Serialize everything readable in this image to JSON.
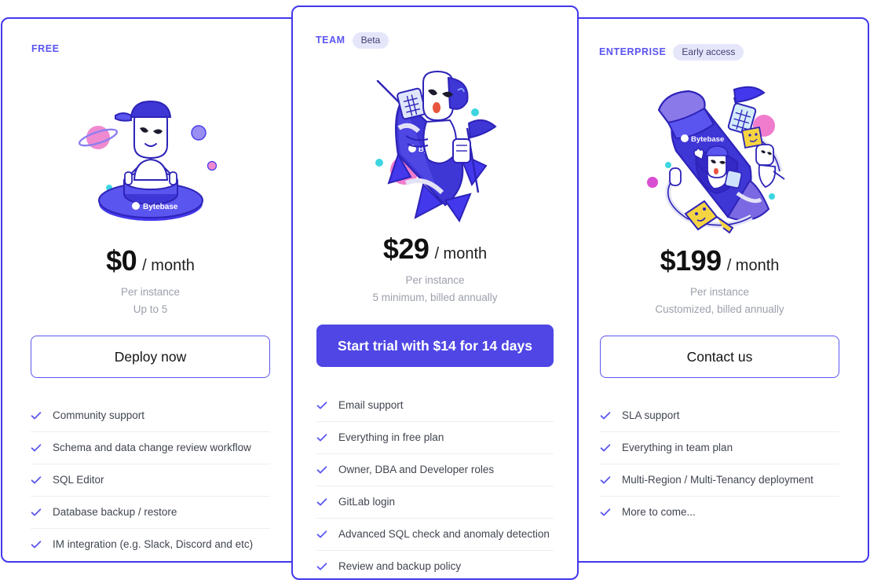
{
  "plans": [
    {
      "id": "free",
      "tier": "FREE",
      "badge": null,
      "illustration_name": "ufo-astronaut-illustration",
      "brand_text": "Bytebase",
      "price_amount": "$0",
      "price_period": "/ month",
      "note_line1": "Per instance",
      "note_line2": "Up to 5",
      "cta_label": "Deploy now",
      "cta_style": "outline",
      "features": [
        "Community support",
        "Schema and data change review workflow",
        "SQL Editor",
        "Database backup / restore",
        "IM integration (e.g. Slack, Discord and etc)"
      ]
    },
    {
      "id": "team",
      "tier": "TEAM",
      "badge": "Beta",
      "illustration_name": "rocket-astronaut-illustration",
      "brand_text": "Bytebase",
      "price_amount": "$29",
      "price_period": "/ month",
      "note_line1": "Per instance",
      "note_line2": "5 minimum, billed annually",
      "cta_label": "Start trial with $14 for 14 days",
      "cta_style": "solid",
      "features": [
        "Email support",
        "Everything in free plan",
        "Owner, DBA and Developer roles",
        "GitLab login",
        "Advanced SQL check and anomaly detection",
        "Review and backup policy"
      ]
    },
    {
      "id": "enterprise",
      "tier": "ENTERPRISE",
      "badge": "Early access",
      "illustration_name": "space-capsule-crew-illustration",
      "brand_text": "Bytebase",
      "price_amount": "$199",
      "price_period": "/ month",
      "note_line1": "Per instance",
      "note_line2": "Customized, billed annually",
      "cta_label": "Contact us",
      "cta_style": "outline",
      "features": [
        "SLA support",
        "Everything in team plan",
        "Multi-Region / Multi-Tenancy deployment",
        "More to come..."
      ]
    }
  ],
  "icons": {
    "check": "check-icon"
  },
  "colors": {
    "brand_purple": "#4338ec",
    "accent_purple": "#5b55ef",
    "cta_solid_bg": "#4f46e5",
    "pill_bg": "#e6e6fb",
    "muted_text": "#9ca0ab",
    "feature_text": "#40454f",
    "divider": "#eeeef1",
    "planet_pink": "#f07ccd",
    "planet_violet": "#8b7ff0",
    "dot_teal": "#3dd6e0",
    "key_yellow": "#f5d442"
  }
}
